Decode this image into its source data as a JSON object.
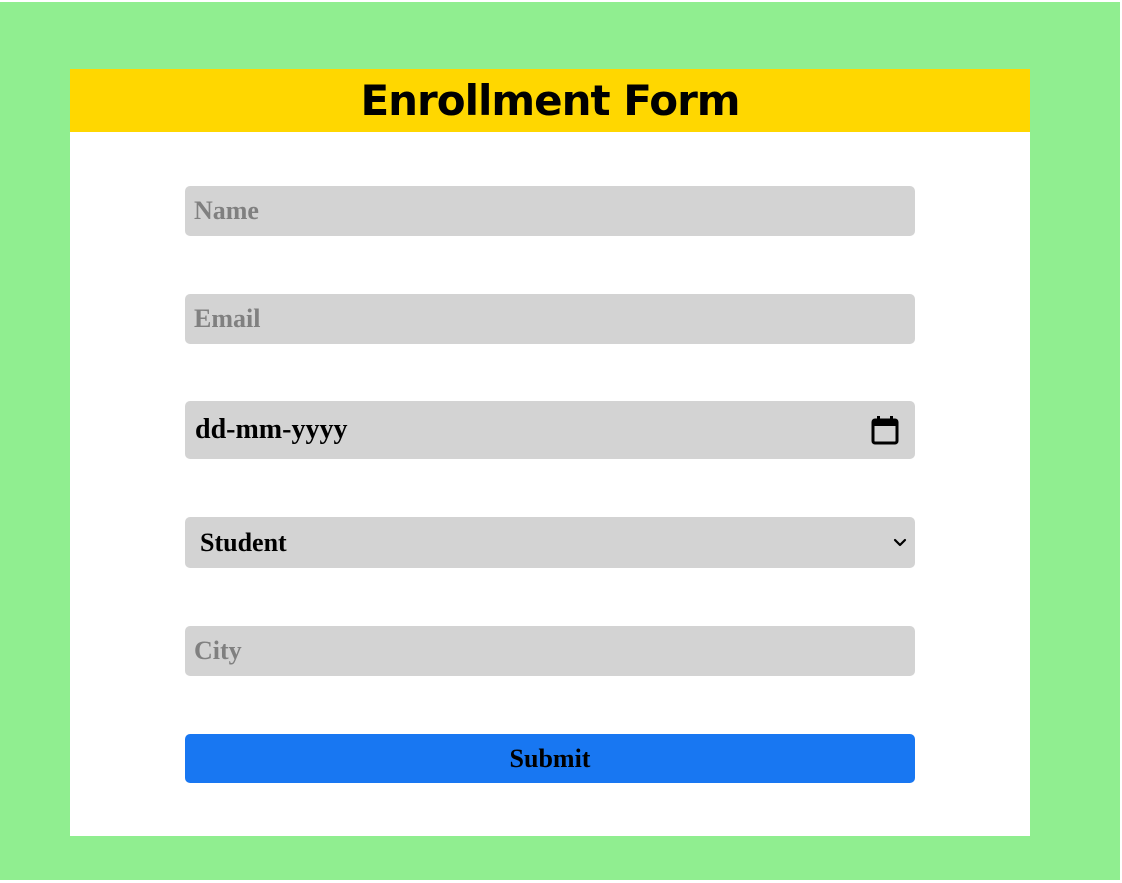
{
  "form": {
    "title": "Enrollment Form",
    "name_placeholder": "Name",
    "email_placeholder": "Email",
    "date_placeholder": "dd-mm-yyyy",
    "role_selected": "Student",
    "city_placeholder": "City",
    "submit_label": "Submit"
  },
  "icons": {
    "date": "calendar-icon",
    "select": "chevron-down-icon"
  },
  "colors": {
    "page_background": "#90ee90",
    "header_background": "#ffd700",
    "card_background": "#ffffff",
    "field_background": "#d3d3d3",
    "placeholder_text": "#808080",
    "submit_background": "#1877f2"
  }
}
